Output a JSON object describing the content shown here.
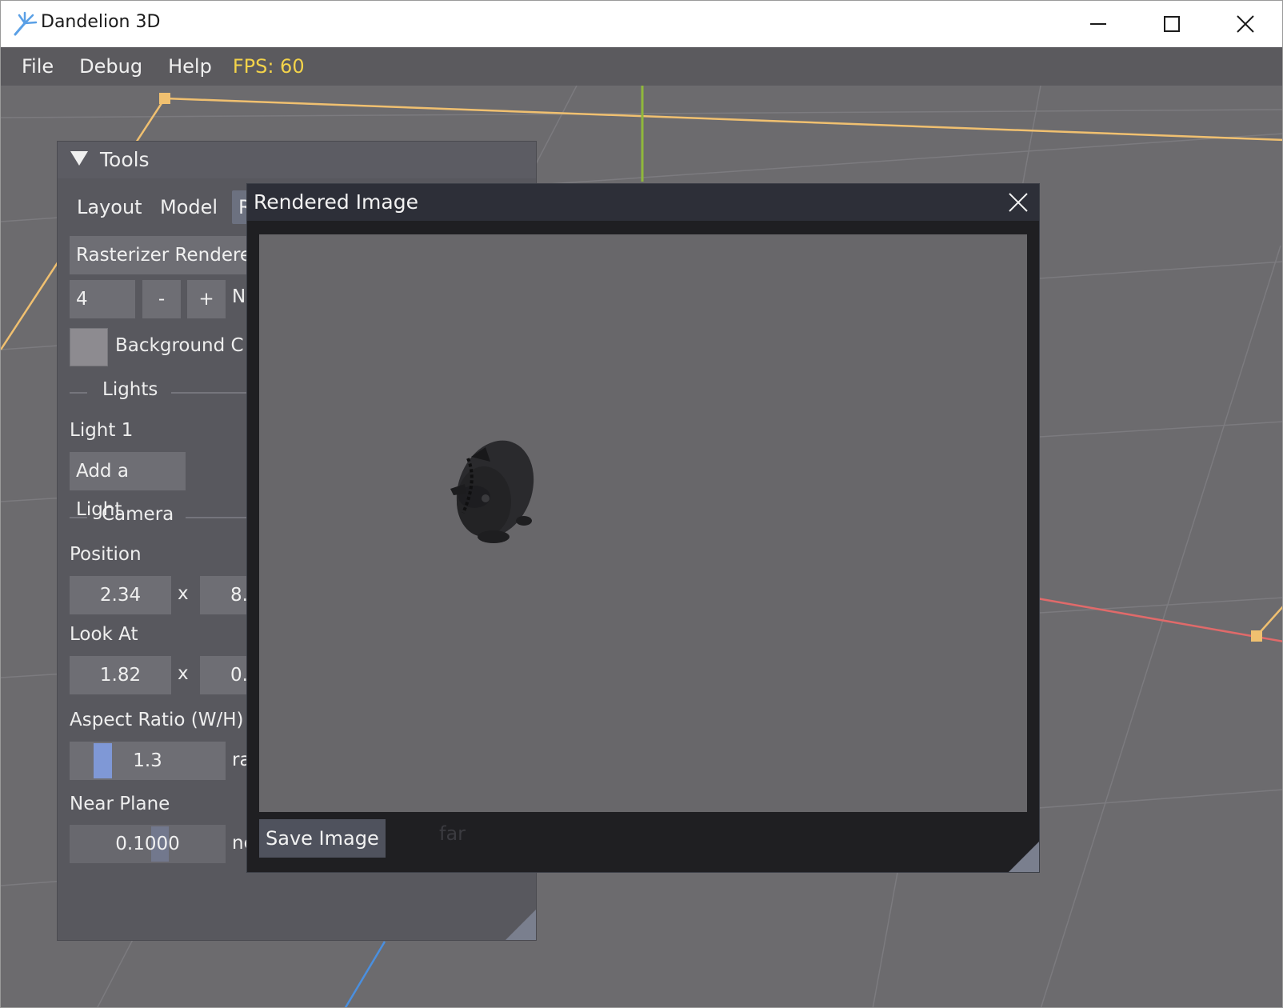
{
  "window": {
    "title": "Dandelion 3D",
    "controls": {
      "minimize": "minimize-icon",
      "maximize": "maximize-icon",
      "close": "close-icon"
    }
  },
  "menubar": {
    "items": [
      "File",
      "Debug",
      "Help"
    ],
    "fps": "FPS: 60"
  },
  "tools": {
    "title": "Tools",
    "tabs": [
      "Layout",
      "Model",
      "R"
    ],
    "renderer_select": "Rasterizer Rendere",
    "samples": {
      "value": "4",
      "minus": "-",
      "plus": "+",
      "label_partial": "N"
    },
    "background_label": "Background C",
    "lights_section": "Lights",
    "light_item": "Light 1",
    "add_light": "Add a Light",
    "camera_section": "Camera",
    "position_label": "Position",
    "position": {
      "x": "2.34",
      "x_suffix": "x",
      "y_partial": "8."
    },
    "lookat_label": "Look At",
    "lookat": {
      "x": "1.82",
      "x_suffix": "x",
      "y_partial": "0."
    },
    "aspect_label": "Aspect Ratio (W/H)",
    "aspect": {
      "value": "1.3",
      "suffix_partial": "ra"
    },
    "near_label": "Near Plane",
    "near": {
      "value": "0.1000",
      "suffix_partial": "ne"
    },
    "far_ghost": "far"
  },
  "render_dialog": {
    "title": "Rendered Image",
    "save": "Save Image"
  },
  "colors": {
    "viewport_bg": "#6c6b6e",
    "fps": "#f3d34a",
    "yellow_axis": "#f0c070",
    "red_axis": "#e06a6a",
    "green_axis": "#8fb83b",
    "blue_axis": "#4a8fdf",
    "slider": "#7f98d6"
  }
}
